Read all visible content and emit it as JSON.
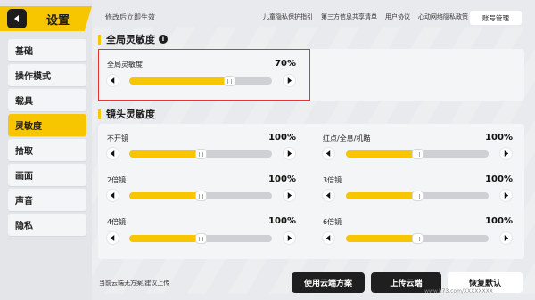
{
  "sidebar": {
    "title": "设置",
    "items": [
      {
        "label": "基础",
        "active": false
      },
      {
        "label": "操作模式",
        "active": false
      },
      {
        "label": "载具",
        "active": false
      },
      {
        "label": "灵敏度",
        "active": true
      },
      {
        "label": "拾取",
        "active": false
      },
      {
        "label": "画面",
        "active": false
      },
      {
        "label": "声音",
        "active": false
      },
      {
        "label": "隐私",
        "active": false
      }
    ]
  },
  "topbar": {
    "hint": "修改后立即生效",
    "links": [
      "儿童隐私保护指引",
      "第三方信息共享清单",
      "用户协议",
      "心动网络隐私政策"
    ],
    "account_button": "账号管理"
  },
  "global": {
    "heading": "全局灵敏度",
    "slider": {
      "label": "全局灵敏度",
      "value": "70%",
      "fraction": 0.7
    }
  },
  "scope": {
    "heading": "镜头灵敏度",
    "left": [
      {
        "label": "不开镜",
        "value": "100%",
        "fraction": 0.5
      },
      {
        "label": "2倍镜",
        "value": "100%",
        "fraction": 0.5
      },
      {
        "label": "4倍镜",
        "value": "100%",
        "fraction": 0.5
      }
    ],
    "right": [
      {
        "label": "红点/全息/机瞄",
        "value": "100%",
        "fraction": 0.5
      },
      {
        "label": "3倍镜",
        "value": "100%",
        "fraction": 0.5
      },
      {
        "label": "6倍镜",
        "value": "100%",
        "fraction": 0.5
      }
    ]
  },
  "footer": {
    "hint": "当前云端无方案,建议上传",
    "use_cloud": "使用云端方案",
    "upload_cloud": "上传云端",
    "restore_default": "恢复默认",
    "watermark": "www.k73.com/XXXXXXXX"
  },
  "colors": {
    "accent": "#f7c600",
    "dark": "#1f1f1f",
    "highlight": "#e43333"
  }
}
